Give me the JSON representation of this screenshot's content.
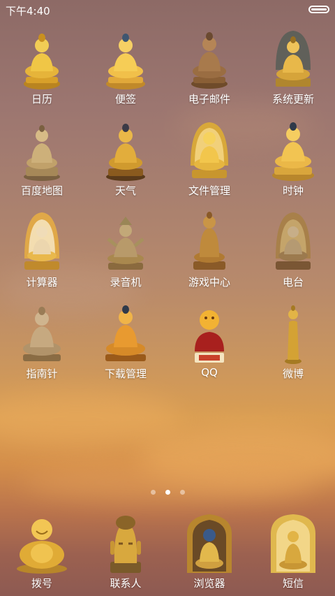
{
  "status": {
    "time": "下午4:40"
  },
  "apps": [
    {
      "label": "日历",
      "icon": "seated-buddha-gold-icon"
    },
    {
      "label": "便签",
      "icon": "seated-buddha-gold-icon"
    },
    {
      "label": "电子邮件",
      "icon": "seated-buddha-bronze-icon"
    },
    {
      "label": "系统更新",
      "icon": "seated-buddha-throne-icon"
    },
    {
      "label": "百度地图",
      "icon": "seated-buddha-bronze-icon"
    },
    {
      "label": "天气",
      "icon": "seated-buddha-gold-icon"
    },
    {
      "label": "文件管理",
      "icon": "seated-buddha-halo-icon"
    },
    {
      "label": "时钟",
      "icon": "seated-buddha-gold-icon"
    },
    {
      "label": "计算器",
      "icon": "seated-buddha-halo-icon"
    },
    {
      "label": "录音机",
      "icon": "tara-statue-icon"
    },
    {
      "label": "游戏中心",
      "icon": "seated-buddha-bronze-icon"
    },
    {
      "label": "电台",
      "icon": "seated-buddha-halo-icon"
    },
    {
      "label": "指南针",
      "icon": "seated-buddha-bronze-icon"
    },
    {
      "label": "下载管理",
      "icon": "seated-buddha-halo-icon"
    },
    {
      "label": "QQ",
      "icon": "laughing-monk-icon"
    },
    {
      "label": "微博",
      "icon": "standing-buddha-icon"
    }
  ],
  "page_indicator": {
    "count": 3,
    "active": 2
  },
  "dock": [
    {
      "label": "拨号",
      "icon": "laughing-buddha-icon"
    },
    {
      "label": "联系人",
      "icon": "buddha-head-icon"
    },
    {
      "label": "浏览器",
      "icon": "buddha-shrine-icon"
    },
    {
      "label": "短信",
      "icon": "buddha-shrine-gold-icon"
    }
  ]
}
